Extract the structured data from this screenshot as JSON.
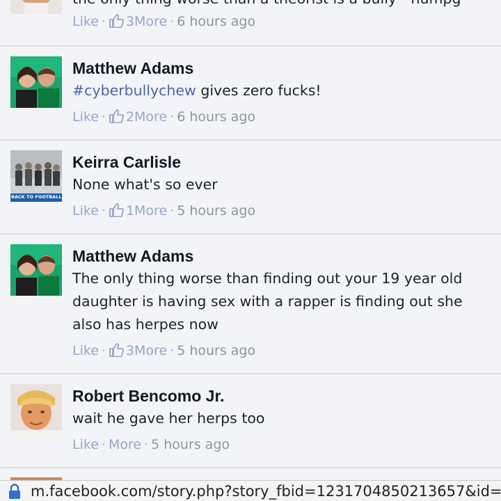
{
  "top_partial": {
    "text": "the only thing worse than a theorist is a bully - humpg",
    "like_label": "Like",
    "reaction_count": "3",
    "more_label": "More",
    "time": "6 hours ago"
  },
  "comments": [
    {
      "author": "Matthew Adams",
      "hashtag": "#cyberbullychew",
      "text": " gives zero fucks!",
      "like_label": "Like",
      "reaction_count": "2",
      "more_label": "More",
      "time": "6 hours ago"
    },
    {
      "author": "Keirra Carlisle",
      "text": "None what's so ever",
      "avatar_caption": "BACK TO FOOTBALL",
      "like_label": "Like",
      "reaction_count": "1",
      "more_label": "More",
      "time": "5 hours ago"
    },
    {
      "author": "Matthew Adams",
      "text": "The only thing worse than finding out your 19 year old daughter is having sex with a rapper is finding out she also has herpes now",
      "like_label": "Like",
      "reaction_count": "3",
      "more_label": "More",
      "time": "5 hours ago"
    },
    {
      "author": "Robert Bencomo Jr.",
      "text": "wait he gave her herps too",
      "like_label": "Like",
      "more_label": "More",
      "time": "5 hours ago"
    }
  ],
  "url_bar": {
    "url": "m.facebook.com/story.php?story_fbid=1231704850213657&id="
  },
  "colors": {
    "background": "#f3f4f8",
    "link": "#98a5c7",
    "hashtag": "#4b67a1",
    "lock": "#2d6fd6"
  }
}
